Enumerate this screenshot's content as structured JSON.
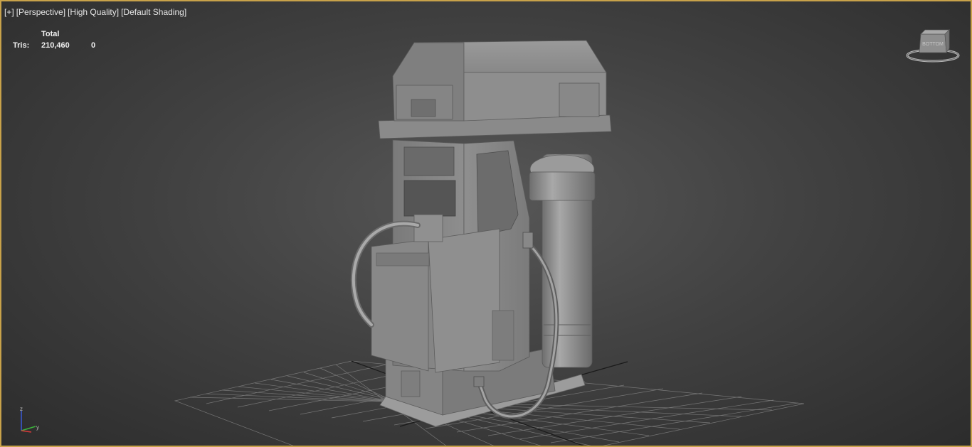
{
  "viewport": {
    "labels": [
      "[+]",
      "[Perspective]",
      "[High Quality]",
      "[Default Shading]"
    ]
  },
  "stats": {
    "header": "Total",
    "tris_label": "Tris:",
    "tris_total": "210,460",
    "tris_selected": "0"
  },
  "viewcube": {
    "face_label": "BOTTOM"
  },
  "axis": {
    "z_label": "z",
    "y_label": "y"
  },
  "colors": {
    "viewport_border": "#c8a24a",
    "grid": "#8a8a8a",
    "model": "#8c8c8c"
  },
  "icons": {
    "viewcube": "viewcube-icon",
    "axis": "axis-tripod-icon"
  }
}
